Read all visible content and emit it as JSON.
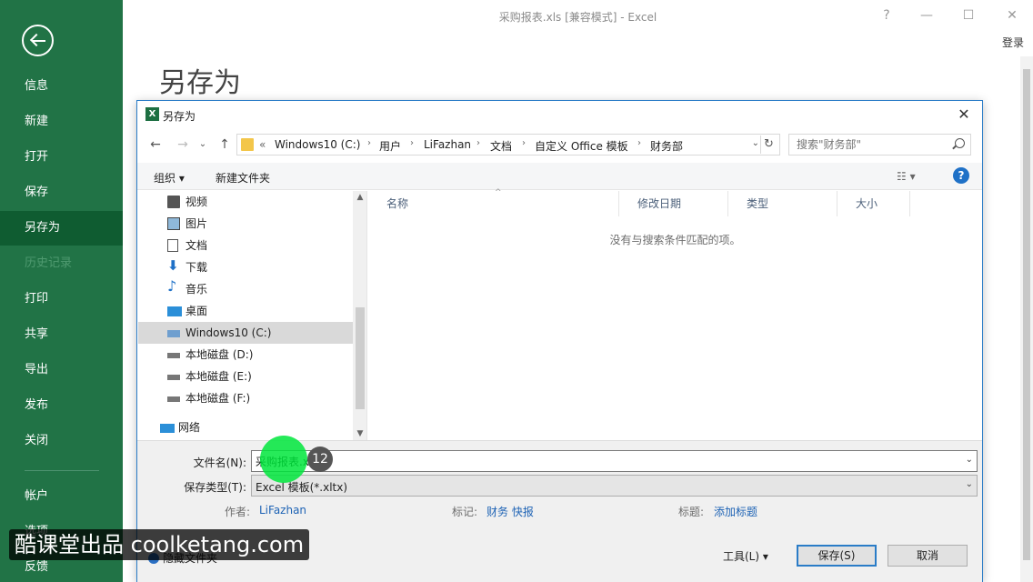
{
  "window": {
    "title": "采购报表.xls  [兼容模式] - Excel",
    "help_glyph": "?",
    "min_glyph": "—",
    "max_glyph": "☐",
    "close_glyph": "✕",
    "login": "登录"
  },
  "backstage": {
    "page_title": "另存为",
    "items": [
      {
        "label": "信息"
      },
      {
        "label": "新建"
      },
      {
        "label": "打开"
      },
      {
        "label": "保存"
      },
      {
        "label": "另存为"
      },
      {
        "label": "历史记录"
      },
      {
        "label": "打印"
      },
      {
        "label": "共享"
      },
      {
        "label": "导出"
      },
      {
        "label": "发布"
      },
      {
        "label": "关闭"
      },
      {
        "label": "帐户"
      },
      {
        "label": "选项"
      },
      {
        "label": "反馈"
      }
    ]
  },
  "dialog": {
    "title": "另存为",
    "icon_letter": "X",
    "close_glyph": "✕",
    "nav": {
      "back": "←",
      "forward": "→",
      "dropdown": "⌄",
      "up": "↑"
    },
    "breadcrumbs": [
      "«",
      "Windows10 (C:)",
      "用户",
      "LiFazhan",
      "文档",
      "自定义 Office 模板",
      "财务部"
    ],
    "crumb_sep": "›",
    "addr_drop": "⌄",
    "refresh_glyph": "↻",
    "search_placeholder": "搜索\"财务部\"",
    "toolbar": {
      "organize": "组织 ▾",
      "new_folder": "新建文件夹",
      "view": "☷ ▾",
      "help": "?"
    },
    "tree": [
      {
        "label": "视频",
        "icon": "video-icon"
      },
      {
        "label": "图片",
        "icon": "pictures-icon"
      },
      {
        "label": "文档",
        "icon": "documents-icon"
      },
      {
        "label": "下载",
        "icon": "download-icon"
      },
      {
        "label": "音乐",
        "icon": "music-icon"
      },
      {
        "label": "桌面",
        "icon": "desktop-icon"
      },
      {
        "label": "Windows10 (C:)",
        "icon": "drive-c-icon"
      },
      {
        "label": "本地磁盘 (D:)",
        "icon": "drive-icon"
      },
      {
        "label": "本地磁盘 (E:)",
        "icon": "drive-icon"
      },
      {
        "label": "本地磁盘 (F:)",
        "icon": "drive-icon"
      },
      {
        "label": "网络",
        "icon": "network-icon"
      }
    ],
    "scroll_up": "▲",
    "scroll_down": "▼",
    "columns": [
      "名称",
      "修改日期",
      "类型",
      "大小"
    ],
    "sort_caret": "^",
    "empty_message": "没有与搜索条件匹配的项。",
    "filename_label": "文件名(N):",
    "filename_value": "采购报表.xls",
    "filetype_label": "保存类型(T):",
    "filetype_value": "Excel 模板(*.xltx)",
    "dropdown_glyph": "⌄",
    "author_label": "作者:",
    "author_value": "LiFazhan",
    "tags_label": "标记:",
    "tags_value": "财务 快报",
    "title_label": "标题:",
    "title_value": "添加标题",
    "hide_folders": "隐藏文件夹",
    "tools": "工具(L)    ▾",
    "save": "保存(S)",
    "cancel": "取消"
  },
  "overlay": {
    "step_number": "12",
    "watermark": "酷课堂出品 coolketang.com"
  },
  "colors": {
    "backstage_green": "#217346",
    "active_green": "#0f5c31",
    "dialog_border": "#2a7cc7",
    "cursor_highlight": "#00e63c"
  }
}
